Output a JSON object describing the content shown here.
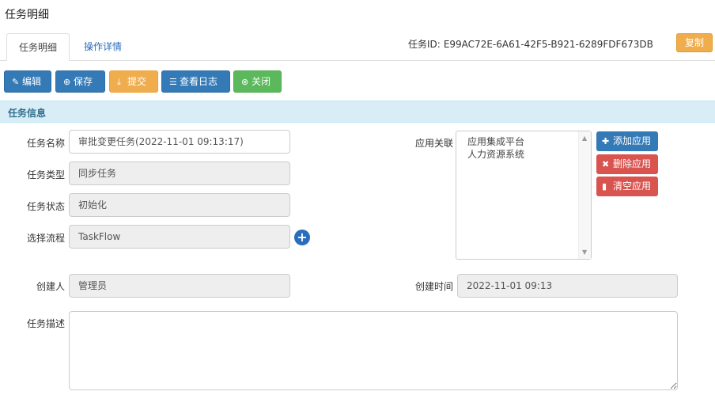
{
  "page": {
    "title": "任务明细"
  },
  "tabs": [
    {
      "label": "任务明细",
      "active": true
    },
    {
      "label": "操作详情",
      "active": false
    }
  ],
  "task_id": {
    "label": "任务ID:",
    "value": "E99AC72E-6A61-42F5-B921-6289FDF673DB",
    "copy_label": "复制"
  },
  "toolbar": {
    "edit": "编辑",
    "save": "保存",
    "submit": "提交",
    "view_log": "查看日志",
    "close": "关闭"
  },
  "section": {
    "title": "任务信息"
  },
  "form": {
    "name_label": "任务名称",
    "name_value": "审批变更任务(2022-11-01 09:13:17)",
    "type_label": "任务类型",
    "type_value": "同步任务",
    "status_label": "任务状态",
    "status_value": "初始化",
    "flow_label": "选择流程",
    "flow_value": "TaskFlow",
    "creator_label": "创建人",
    "creator_value": "管理员",
    "created_time_label": "创建时间",
    "created_time_value": "2022-11-01 09:13",
    "desc_label": "任务描述",
    "desc_value": ""
  },
  "apps": {
    "label": "应用关联",
    "items": [
      "应用集成平台",
      "人力资源系统"
    ],
    "add": "添加应用",
    "remove": "删除应用",
    "clear": "清空应用"
  },
  "colors": {
    "primary": "#337ab7",
    "warning": "#f0ad4e",
    "success": "#5cb85c",
    "danger": "#d9534f",
    "section_bg": "#d9edf7"
  }
}
